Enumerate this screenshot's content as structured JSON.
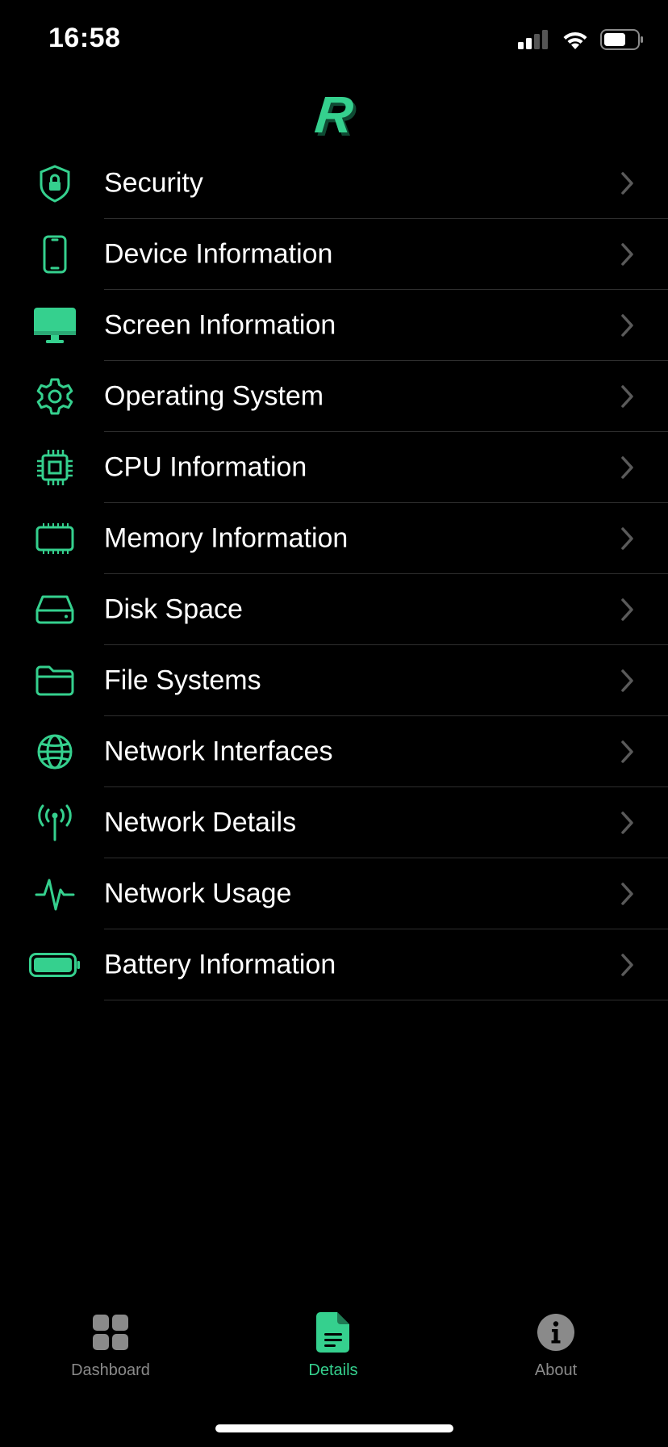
{
  "status": {
    "time": "16:58"
  },
  "logo": {
    "text": "R",
    "color": "#35d08e"
  },
  "accent_color": "#35d08e",
  "menu": {
    "items": [
      {
        "label": "Security",
        "icon": "shield-lock-icon"
      },
      {
        "label": "Device Information",
        "icon": "phone-icon"
      },
      {
        "label": "Screen Information",
        "icon": "monitor-icon"
      },
      {
        "label": "Operating System",
        "icon": "gear-icon"
      },
      {
        "label": "CPU Information",
        "icon": "cpu-chip-icon"
      },
      {
        "label": "Memory Information",
        "icon": "memory-icon"
      },
      {
        "label": "Disk Space",
        "icon": "disk-drive-icon"
      },
      {
        "label": "File Systems",
        "icon": "folder-icon"
      },
      {
        "label": "Network Interfaces",
        "icon": "globe-icon"
      },
      {
        "label": "Network Details",
        "icon": "antenna-icon"
      },
      {
        "label": "Network Usage",
        "icon": "waveform-icon"
      },
      {
        "label": "Battery Information",
        "icon": "battery-icon"
      }
    ]
  },
  "tabbar": {
    "tabs": [
      {
        "label": "Dashboard",
        "icon": "grid-icon",
        "active": false
      },
      {
        "label": "Details",
        "icon": "document-icon",
        "active": true
      },
      {
        "label": "About",
        "icon": "info-icon",
        "active": false
      }
    ]
  }
}
